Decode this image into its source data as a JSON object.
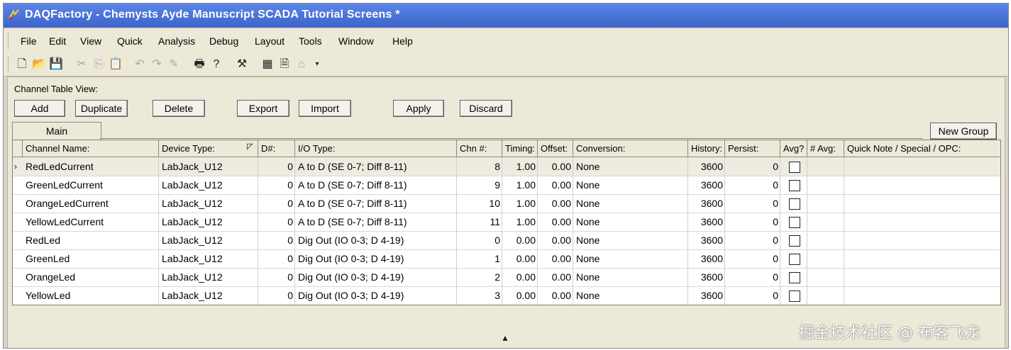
{
  "window": {
    "title": "DAQFactory - Chemysts Ayde Manuscript SCADA Tutorial Screens *"
  },
  "menu": [
    {
      "label": "File"
    },
    {
      "label": "Edit"
    },
    {
      "label": "View"
    },
    {
      "label": "Quick"
    },
    {
      "label": "Analysis"
    },
    {
      "label": "Debug"
    },
    {
      "label": "Layout"
    },
    {
      "label": "Tools"
    },
    {
      "label": "Window"
    },
    {
      "label": "Help"
    }
  ],
  "toolbar_icons": [
    "new-file-icon",
    "open-folder-icon",
    "save-icon",
    "cut-icon",
    "copy-icon",
    "paste-icon",
    "undo-icon",
    "redo-icon",
    "brush-icon",
    "print-icon",
    "help-icon",
    "tools-icon",
    "calculator-icon",
    "document-icon",
    "dome-icon"
  ],
  "panel": {
    "label": "Channel Table View:",
    "buttons": {
      "add": "Add",
      "duplicate": "Duplicate",
      "delete": "Delete",
      "export": "Export",
      "import": "Import",
      "apply": "Apply",
      "discard": "Discard"
    },
    "tab": "Main",
    "new_group": "New Group"
  },
  "table": {
    "headers": {
      "name": "Channel Name:",
      "device": "Device Type:",
      "dnum": "D#:",
      "iotype": "I/O Type:",
      "chn": "Chn #:",
      "timing": "Timing:",
      "offset": "Offset:",
      "conversion": "Conversion:",
      "history": "History:",
      "persist": "Persist:",
      "avg": "Avg?",
      "navg": "# Avg:",
      "note": "Quick Note / Special / OPC:"
    },
    "rows": [
      {
        "name": "RedLedCurrent",
        "device": "LabJack_U12",
        "dnum": "0",
        "iotype": "A to D (SE 0-7; Diff 8-11)",
        "chn": "8",
        "timing": "1.00",
        "offset": "0.00",
        "conversion": "None",
        "history": "3600",
        "persist": "0"
      },
      {
        "name": "GreenLedCurrent",
        "device": "LabJack_U12",
        "dnum": "0",
        "iotype": "A to D (SE 0-7; Diff 8-11)",
        "chn": "9",
        "timing": "1.00",
        "offset": "0.00",
        "conversion": "None",
        "history": "3600",
        "persist": "0"
      },
      {
        "name": "OrangeLedCurrent",
        "device": "LabJack_U12",
        "dnum": "0",
        "iotype": "A to D (SE 0-7; Diff 8-11)",
        "chn": "10",
        "timing": "1.00",
        "offset": "0.00",
        "conversion": "None",
        "history": "3600",
        "persist": "0"
      },
      {
        "name": "YellowLedCurrent",
        "device": "LabJack_U12",
        "dnum": "0",
        "iotype": "A to D (SE 0-7; Diff 8-11)",
        "chn": "11",
        "timing": "1.00",
        "offset": "0.00",
        "conversion": "None",
        "history": "3600",
        "persist": "0"
      },
      {
        "name": "RedLed",
        "device": "LabJack_U12",
        "dnum": "0",
        "iotype": "Dig Out (IO 0-3; D 4-19)",
        "chn": "0",
        "timing": "0.00",
        "offset": "0.00",
        "conversion": "None",
        "history": "3600",
        "persist": "0"
      },
      {
        "name": "GreenLed",
        "device": "LabJack_U12",
        "dnum": "0",
        "iotype": "Dig Out (IO 0-3; D 4-19)",
        "chn": "1",
        "timing": "0.00",
        "offset": "0.00",
        "conversion": "None",
        "history": "3600",
        "persist": "0"
      },
      {
        "name": "OrangeLed",
        "device": "LabJack_U12",
        "dnum": "0",
        "iotype": "Dig Out (IO 0-3; D 4-19)",
        "chn": "2",
        "timing": "0.00",
        "offset": "0.00",
        "conversion": "None",
        "history": "3600",
        "persist": "0"
      },
      {
        "name": "YellowLed",
        "device": "LabJack_U12",
        "dnum": "0",
        "iotype": "Dig Out (IO 0-3; D 4-19)",
        "chn": "3",
        "timing": "0.00",
        "offset": "0.00",
        "conversion": "None",
        "history": "3600",
        "persist": "0"
      }
    ]
  },
  "watermark": "掘金技术社区 @ 布客飞龙"
}
